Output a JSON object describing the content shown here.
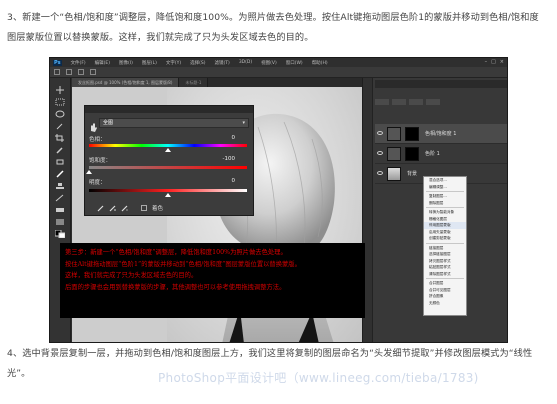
{
  "article": {
    "para1": "3、新建一个“色相/饱和度”调整层，降低饱和度100%。为照片做去色处理。按住Alt键拖动图层色阶1的蒙版并移动到色相/饱和度图层蒙版位置以替换蒙版。这样，我们就完成了只为头发区域去色的目的。",
    "para2": "4、选中背景层复制一层，并拖动到色相/饱和度图层上方，我们这里将复制的图层命名为“头发细节提取”并修改图层模式为“线性光”。",
    "watermark": "PhotoShop平面设计吧（www.lineeg.com/tieba/1783)"
  },
  "ps": {
    "logo": "Ps",
    "menus": [
      "文件(F)",
      "编辑(E)",
      "图像(I)",
      "图层(L)",
      "文字(Y)",
      "选择(S)",
      "滤镜(T)",
      "3D(D)",
      "视图(V)",
      "窗口(W)",
      "帮助(H)"
    ],
    "tabs": [
      "发丝抠图.psd @ 100% (色相/饱和度 1, 图层蒙版/8)",
      "未标题-1"
    ]
  },
  "properties": {
    "preset": "全图",
    "hue_label": "色相：",
    "hue_value": "0",
    "hue_level": 0,
    "saturation_label": "饱和度：",
    "saturation_value": "-100",
    "saturation_level": -100,
    "lightness_label": "明度：",
    "lightness_value": "0",
    "lightness_level": 0,
    "colorize_label": "着色"
  },
  "layers": [
    {
      "name": "色相/饱和度 1",
      "type": "adjustment",
      "selected": true
    },
    {
      "name": "色阶 1",
      "type": "adjustment",
      "selected": false
    },
    {
      "name": "背景",
      "type": "photo",
      "selected": false
    }
  ],
  "context_menu": [
    "混合选项...",
    "编辑调整...",
    "复制图层...",
    "删除图层",
    "转换为智能对象",
    "栅格化图层",
    "停用图层蒙版",
    "启用矢量蒙版",
    "创建剪贴蒙版",
    "链接图层",
    "选择链接图层",
    "拷贝图层样式",
    "粘贴图层样式",
    "清除图层样式",
    "合并图层",
    "合并可见图层",
    "拼合图像",
    "无颜色",
    "红色",
    "橙色",
    "黄色"
  ],
  "note": {
    "line1": "第三步：新建一个“色相/饱和度”调整层，降低饱和度100%为照片做去色处理。",
    "line2": "按住Alt键拖动图层“色阶1”的蒙版并移动到“色相/饱和度”图层蒙版位置以替换蒙版。",
    "line3": "这样，我们就完成了只为头发区域去色的目的。",
    "line4": "后面的步骤也会用到替换蒙版的步骤，其他调整也可以参考使用拖拽调整方法。"
  },
  "colors": {
    "note_text": "#d40000",
    "note_bg": "#000000",
    "ps_panel": "#3c3c3c",
    "watermark": "#c7d3e6"
  }
}
